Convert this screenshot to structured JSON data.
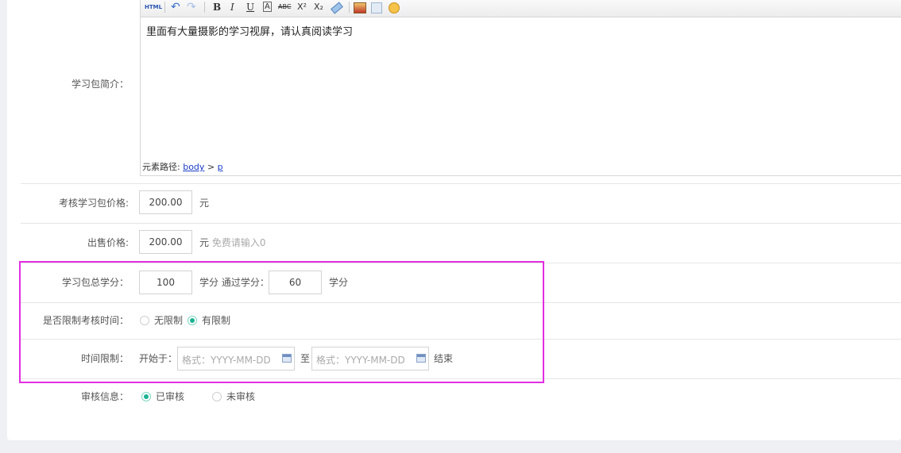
{
  "intro": {
    "label": "学习包简介：",
    "content": "里面有大量摄影的学习视屏，请认真阅读学习",
    "path_prefix": "元素路径:",
    "path_body": "body",
    "path_sep": ">",
    "path_p": "p",
    "toolbar": {
      "html": "HTML",
      "undo": "↶",
      "redo": "↷",
      "bold": "B",
      "italic": "I",
      "underline": "U",
      "border_text": "A",
      "strike": "ABC",
      "superscript": "X²",
      "subscript": "X₂"
    }
  },
  "price": {
    "label": "考核学习包价格:",
    "value": "200.00",
    "unit": "元"
  },
  "sale": {
    "label": "出售价格:",
    "value": "200.00",
    "unit": "元",
    "hint": "免费请输入0"
  },
  "credits": {
    "label": "学习包总学分：",
    "value": "100",
    "unit_pass": "学分 通过学分：",
    "pass_value": "60",
    "unit": "学分"
  },
  "limit_time": {
    "label": "是否限制考核时间：",
    "option_none": "无限制",
    "option_limited": "有限制",
    "selected": "有限制"
  },
  "time_limit": {
    "label": "时间限制：",
    "start_label": "开始于：",
    "start_placeholder": "格式：YYYY-MM-DD",
    "to": "至",
    "end_placeholder": "格式：YYYY-MM-DD",
    "end": "结束"
  },
  "review": {
    "label": "审核信息：",
    "option_approved": "已审核",
    "option_pending": "未审核",
    "selected": "已审核"
  },
  "colors": {
    "accent": "#1ab394",
    "highlight_border": "#e22ee2"
  }
}
